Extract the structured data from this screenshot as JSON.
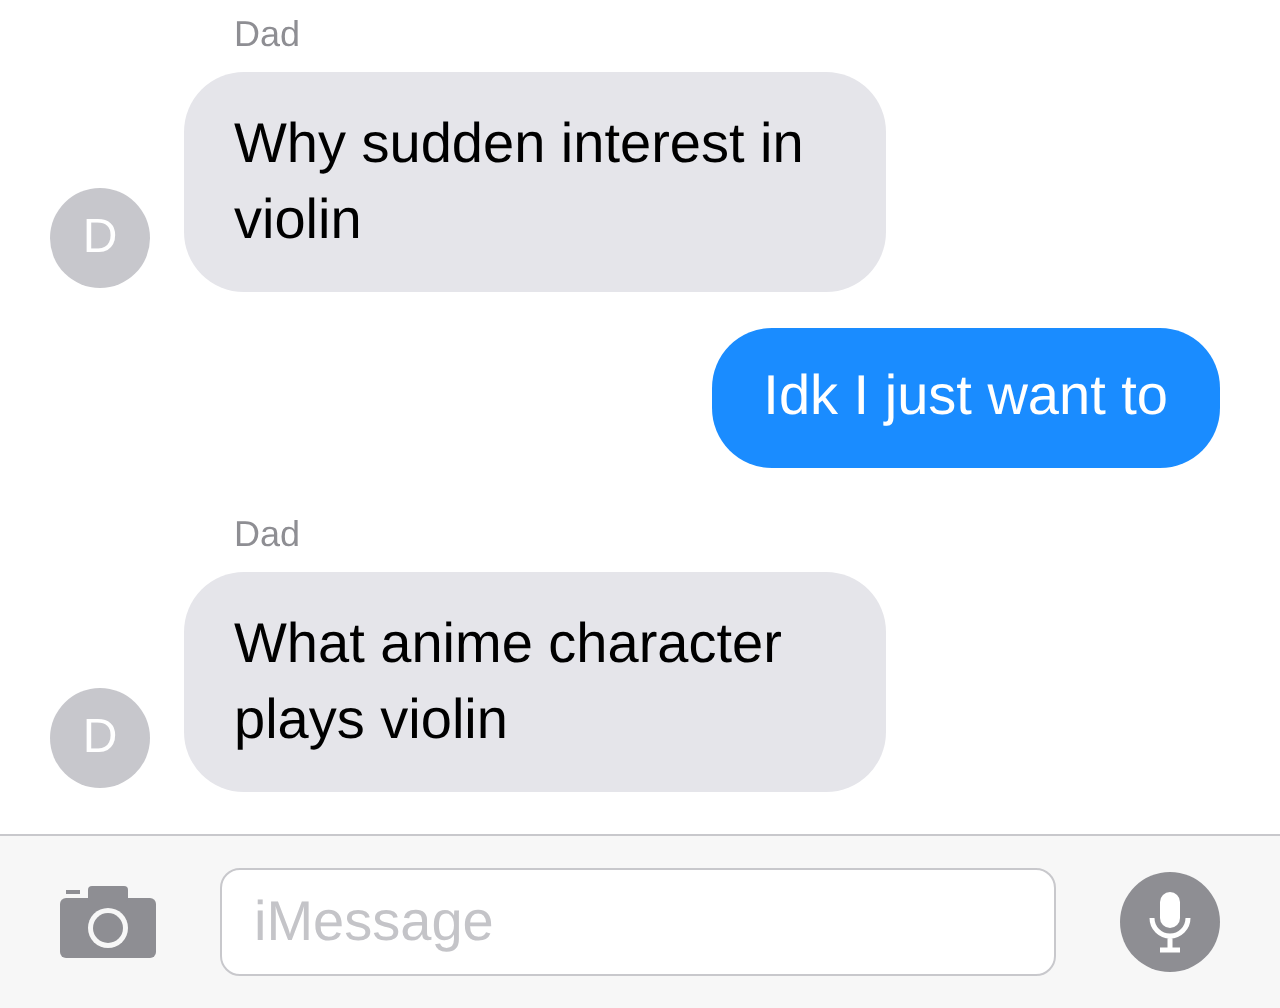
{
  "messages": [
    {
      "kind": "incoming",
      "sender": "Dad",
      "avatar": "D",
      "text": "Why sudden interest in violin"
    },
    {
      "kind": "outgoing",
      "text": "Idk I just want to"
    },
    {
      "kind": "incoming",
      "sender": "Dad",
      "avatar": "D",
      "text": "What anime character plays violin"
    }
  ],
  "composer": {
    "placeholder": "iMessage"
  }
}
